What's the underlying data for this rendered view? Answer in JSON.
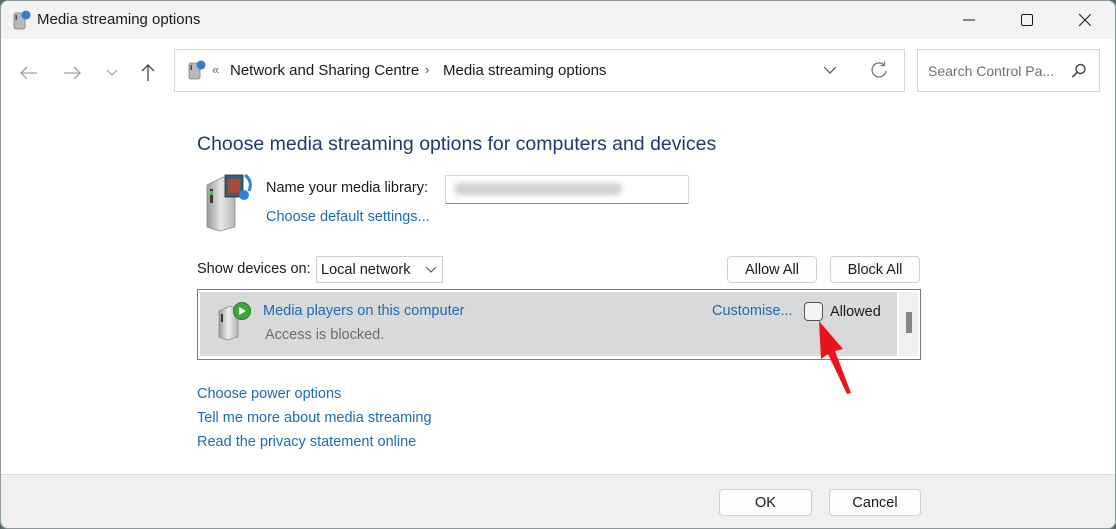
{
  "window": {
    "title": "Media streaming options",
    "controls": {
      "minimize": "minimize",
      "maximize": "maximize",
      "close": "close"
    }
  },
  "nav": {
    "back": "back",
    "forward": "forward",
    "recent": "recent-locations",
    "up": "up"
  },
  "address": {
    "overflow": "«",
    "crumbs": [
      "Network and Sharing Centre",
      "Media streaming options"
    ],
    "separator": "›"
  },
  "search": {
    "placeholder": "Search Control Pa..."
  },
  "main": {
    "heading": "Choose media streaming options for computers and devices",
    "library_label": "Name your media library:",
    "library_value": "(blurred)",
    "default_settings_link": "Choose default settings...",
    "show_devices_label": "Show devices on:",
    "show_devices_value": "Local network",
    "allow_all": "Allow All",
    "block_all": "Block All",
    "devices": [
      {
        "name": "Media players on this computer",
        "status": "Access is blocked.",
        "customise": "Customise...",
        "allowed_label": "Allowed",
        "allowed": false
      }
    ],
    "links": [
      "Choose power options",
      "Tell me more about media streaming",
      "Read the privacy statement online"
    ]
  },
  "footer": {
    "ok": "OK",
    "cancel": "Cancel"
  },
  "colors": {
    "link": "#1c6bb8",
    "heading": "#1e3a6e",
    "annotation_arrow": "#e8141b"
  }
}
